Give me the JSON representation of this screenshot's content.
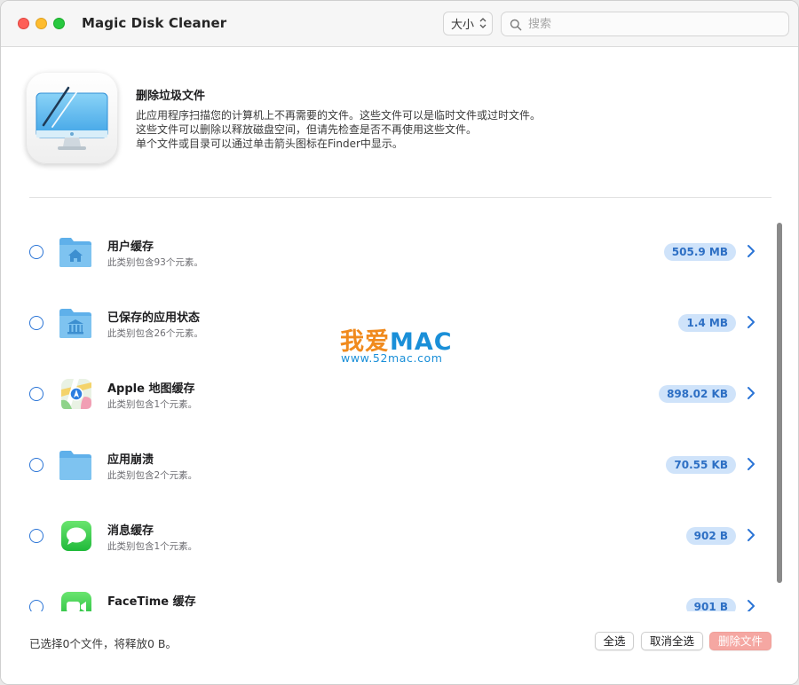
{
  "window": {
    "title": "Magic Disk Cleaner",
    "sort_label": "大小",
    "search_placeholder": "搜索"
  },
  "header": {
    "title": "删除垃圾文件",
    "description": [
      "此应用程序扫描您的计算机上不再需要的文件。这些文件可以是临时文件或过时文件。",
      "这些文件可以删除以释放磁盘空间，但请先检查是否不再使用这些文件。",
      "单个文件或目录可以通过单击箭头图标在Finder中显示。"
    ]
  },
  "items": [
    {
      "name": "用户缓存",
      "count_text": "此类别包含93个元素。",
      "size": "505.9 MB",
      "icon": "home-folder-icon"
    },
    {
      "name": "已保存的应用状态",
      "count_text": "此类别包含26个元素。",
      "size": "1.4 MB",
      "icon": "library-folder-icon"
    },
    {
      "name": "Apple 地图缓存",
      "count_text": "此类别包含1个元素。",
      "size": "898.02 KB",
      "icon": "maps-app-icon"
    },
    {
      "name": "应用崩溃",
      "count_text": "此类别包含2个元素。",
      "size": "70.55 KB",
      "icon": "folder-icon"
    },
    {
      "name": "消息缓存",
      "count_text": "此类别包含1个元素。",
      "size": "902 B",
      "icon": "messages-app-icon"
    },
    {
      "name": "FaceTime 缓存",
      "count_text": "",
      "size": "901 B",
      "icon": "facetime-app-icon"
    }
  ],
  "watermark": {
    "cn": "我爱",
    "en": "MAC",
    "url": "www.52mac.com"
  },
  "footer": {
    "status": "已选择0个文件，将释放0 B。",
    "select_all": "全选",
    "deselect_all": "取消全选",
    "delete": "删除文件"
  },
  "colors": {
    "accent": "#2a74d6",
    "badge_bg": "#cfe3fa",
    "badge_text": "#2d6fc4",
    "delete_button": "#f5a7a2"
  }
}
